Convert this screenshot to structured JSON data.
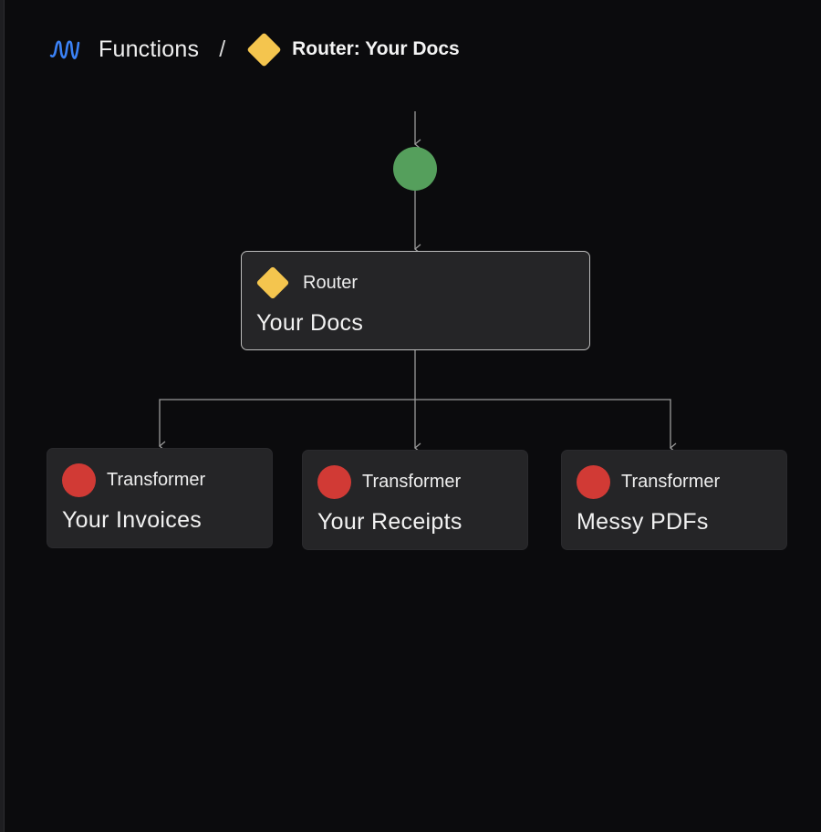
{
  "breadcrumb": {
    "root_icon": "functions-wave-icon",
    "root_label": "Functions",
    "separator": "/",
    "current_icon": "router-diamond-icon",
    "current_label": "Router: Your Docs"
  },
  "diagram": {
    "start_node": {
      "icon": "start-circle",
      "color": "#559f5c"
    },
    "router": {
      "type_label": "Router",
      "title": "Your Docs",
      "icon": "router-diamond-icon",
      "color": "#f4c54e"
    },
    "transformers": [
      {
        "type_label": "Transformer",
        "title": "Your Invoices",
        "icon": "transformer-dot-icon"
      },
      {
        "type_label": "Transformer",
        "title": "Your Receipts",
        "icon": "transformer-dot-icon"
      },
      {
        "type_label": "Transformer",
        "title": "Messy PDFs",
        "icon": "transformer-dot-icon"
      }
    ]
  },
  "colors": {
    "background": "#0b0b0d",
    "node_bg": "#252527",
    "router_accent": "#f4c54e",
    "transformer_accent": "#d13a35",
    "start_accent": "#559f5c",
    "functions_icon": "#3b82f6",
    "edge": "#9a9a9a"
  }
}
